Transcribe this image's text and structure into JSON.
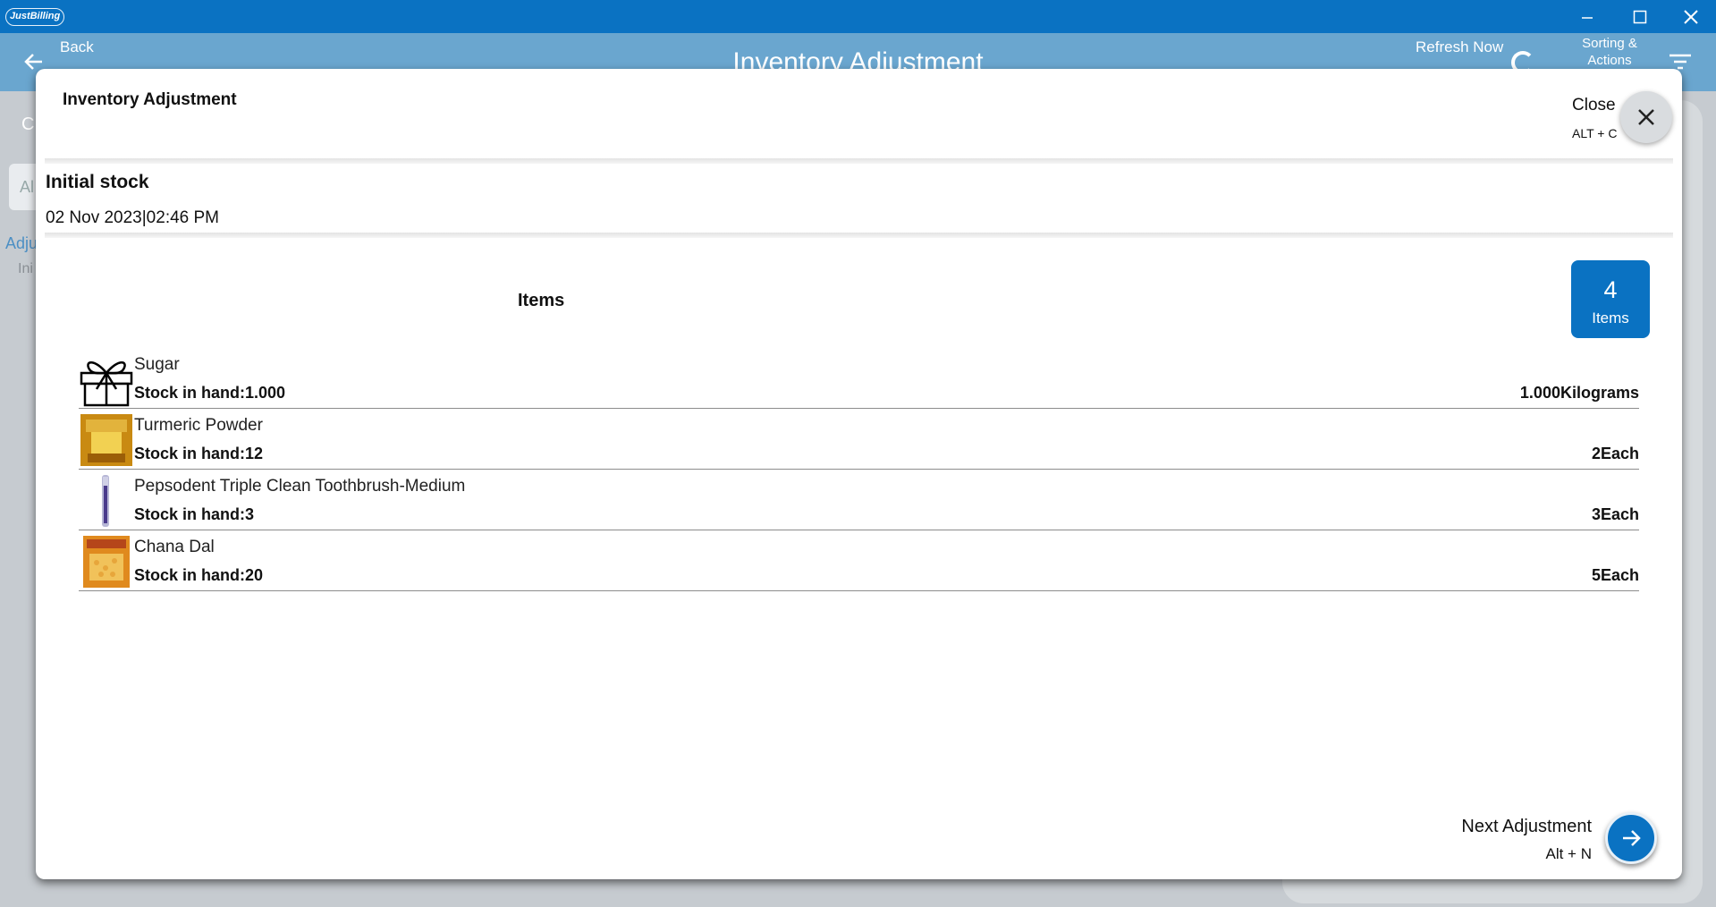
{
  "titlebar": {
    "brand": "JustBilling"
  },
  "appheader": {
    "back_label": "Back",
    "title": "Inventory Adjustment",
    "refresh_label": "Refresh Now",
    "sort_label": "Sorting & Actions"
  },
  "background": {
    "frag_c": "C",
    "frag_input": "Al",
    "frag_adj": "Adju",
    "frag_ini": "Ini"
  },
  "modal": {
    "title": "Inventory Adjustment",
    "close_label": "Close",
    "close_shortcut": "ALT + C",
    "adjustment_type": "Initial stock",
    "adjustment_datetime": "02 Nov 2023|02:46 PM",
    "items_heading": "Items",
    "count": {
      "value": "4",
      "label": "Items"
    },
    "items": [
      {
        "name": "Sugar",
        "stock": "Stock in hand:1.000",
        "qty": "1.000Kilograms",
        "thumb": "gift-box-icon"
      },
      {
        "name": "Turmeric Powder",
        "stock": "Stock in hand:12",
        "qty": "2Each",
        "thumb": "turmeric-packet-image"
      },
      {
        "name": "Pepsodent Triple Clean Toothbrush-Medium",
        "stock": "Stock in hand:3",
        "qty": "3Each",
        "thumb": "toothbrush-image"
      },
      {
        "name": "Chana Dal",
        "stock": "Stock in hand:20",
        "qty": "5Each",
        "thumb": "chana-dal-packet-image"
      }
    ],
    "next_label": "Next Adjustment",
    "next_shortcut": "Alt + N"
  },
  "colors": {
    "primary": "#0a72c2",
    "header": "#6aa6cf"
  }
}
